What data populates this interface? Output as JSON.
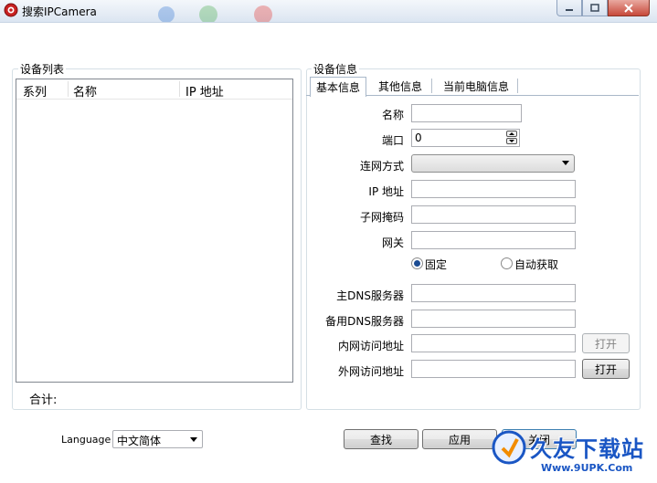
{
  "window": {
    "title": "搜索IPCamera"
  },
  "device_list": {
    "group_label": "设备列表",
    "columns": [
      "系列",
      "名称",
      "IP 地址"
    ],
    "total_label": "合计:"
  },
  "device_info": {
    "group_label": "设备信息",
    "tabs": [
      {
        "label": "基本信息",
        "active": true
      },
      {
        "label": "其他信息",
        "active": false
      },
      {
        "label": "当前电脑信息",
        "active": false
      }
    ],
    "fields": {
      "name_label": "名称",
      "port_label": "端口",
      "port_value": "0",
      "net_mode_label": "连网方式",
      "ip_label": "IP 地址",
      "subnet_label": "子网掩码",
      "gateway_label": "网关",
      "radio_fixed": "固定",
      "radio_auto": "自动获取",
      "dns1_label": "主DNS服务器",
      "dns2_label": "备用DNS服务器",
      "lan_url_label": "内网访问地址",
      "wan_url_label": "外网访问地址",
      "open_label": "打开"
    }
  },
  "footer": {
    "language_label": "Language",
    "language_value": "中文简体",
    "search_label": "查找",
    "apply_label": "应用",
    "close_label": "关闭"
  },
  "watermark": {
    "brand": "久友下载站",
    "url": "Www.9UPK.Com"
  },
  "colors": {
    "accent": "#1c4c93",
    "close_button": "#c7493a",
    "groupbox_border": "#d5dfe5"
  }
}
